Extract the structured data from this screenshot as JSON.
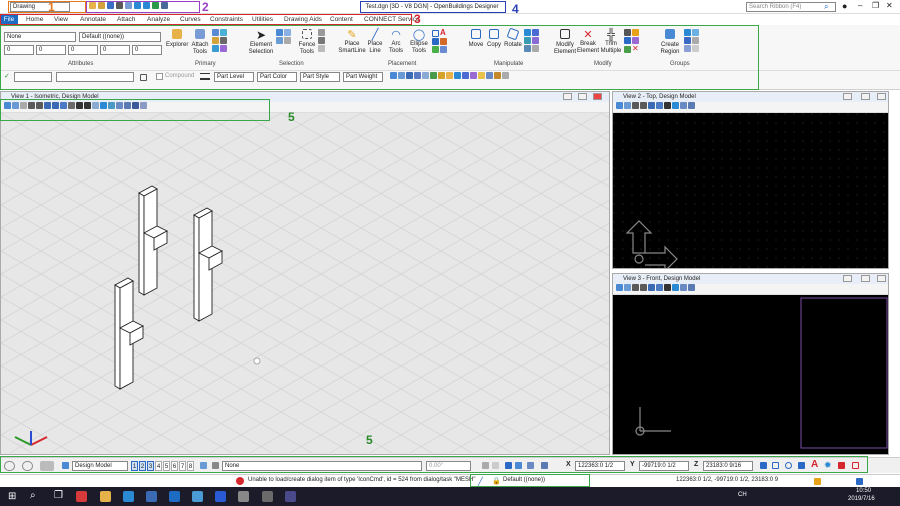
{
  "titlebar": {
    "workflow": "Drawing",
    "title": "Test.dgn [3D - V8 DGN] - OpenBuildings Designer",
    "search_placeholder": "Search Ribbon (F4)"
  },
  "tabs": [
    "File",
    "Home",
    "View",
    "Annotate",
    "Attach",
    "Analyze",
    "Curves",
    "Constraints",
    "Utilities",
    "Drawing Aids",
    "Content",
    "CONNECT Service"
  ],
  "ribbon": {
    "attributes": {
      "level": "None",
      "style": "Default ((none))",
      "weight1": "0",
      "weight2": "0",
      "color": "0",
      "trans": "0",
      "prio": "0",
      "label": "Attributes"
    },
    "primary": {
      "explorer": "Explorer",
      "attach_tools": "Attach Tools",
      "label": "Primary"
    },
    "selection": {
      "element_selection": "Element Selection",
      "fence_tools": "Fence Tools",
      "label": "Selection"
    },
    "placement": {
      "place_smartline": "Place SmartLine",
      "place_line": "Place Line",
      "arc_tools": "Arc Tools",
      "ellipse_tools": "Ellipse Tools",
      "label": "Placement"
    },
    "manipulate": {
      "move": "Move",
      "copy": "Copy",
      "rotate": "Rotate",
      "label": "Manipulate"
    },
    "modify": {
      "modify_element": "Modify Element",
      "break_element": "Break Element",
      "trim_multiple": "Trim Multiple",
      "label": "Modify"
    },
    "groups": {
      "create_region": "Create Region",
      "label": "Groups"
    },
    "row3": {
      "compound": "Compound",
      "part_level": "Part Level",
      "part_color": "Part Color",
      "part_style": "Part Style",
      "part_weight": "Part Weight"
    }
  },
  "views": {
    "v1": "View 1 - Isometric, Design Model",
    "v2": "View 2 - Top, Design Model",
    "v3": "View 3 - Front, Design Model"
  },
  "bottom": {
    "model": "Design Model",
    "view_nums": [
      "1",
      "2",
      "3",
      "4",
      "5",
      "6",
      "7",
      "8"
    ],
    "level": "None",
    "angle": "0.00°",
    "x_label": "X",
    "x_val": "122363:0 1/2",
    "y_label": "Y",
    "y_val": "-99719:0 1/2",
    "z_label": "Z",
    "z_val": "23183:0 9/16"
  },
  "status": {
    "message": "Unable to load/create dialog item of type 'IconCmd', id = 524 from dialog/task \"MESH\"",
    "level": "Default ((none))",
    "coords": "122363:0 1/2, -99719:0 1/2, 23183:0 9"
  },
  "taskbar": {
    "lang": "CH",
    "time": "10:50",
    "date": "2019/7/16"
  },
  "annotations": [
    "1",
    "2",
    "3",
    "4",
    "5",
    "5"
  ],
  "colors": {
    "accent": "#1e6bc4",
    "highlight_orange": "#e8761a",
    "highlight_purple": "#9b3fc4",
    "highlight_red": "#d6262e",
    "highlight_blue": "#2a3fb8",
    "highlight_green": "#3aa84a"
  }
}
